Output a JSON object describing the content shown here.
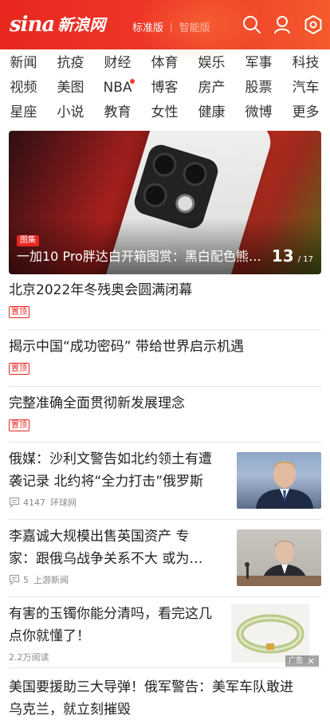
{
  "header": {
    "logo_en": "sina",
    "logo_cn": "新浪网",
    "version_active": "标准版",
    "version_separator": "|",
    "version_inactive": "智能版",
    "icons": [
      "search-icon",
      "user-icon",
      "settings-icon"
    ]
  },
  "nav": {
    "rows": [
      [
        "新闻",
        "抗疫",
        "财经",
        "体育",
        "娱乐",
        "军事",
        "科技"
      ],
      [
        "视频",
        "美图",
        "NBA",
        "博客",
        "房产",
        "股票",
        "汽车"
      ],
      [
        "星座",
        "小说",
        "教育",
        "女性",
        "健康",
        "微博",
        "更多"
      ]
    ],
    "dot_item": "NBA"
  },
  "hero": {
    "tag": "图集",
    "title": "一加10 Pro胖达白开箱图赏：黑白配色熊…",
    "current": "13",
    "total": "/ 17"
  },
  "news": [
    {
      "title": "北京2022年冬残奥会圆满闭幕",
      "pin": "置顶"
    },
    {
      "title": "揭示中国“成功密码” 带给世界启示机遇",
      "pin": "置顶"
    },
    {
      "title": "完整准确全面贯彻新发展理念",
      "pin": "置顶"
    },
    {
      "title_l1": "俄媒：沙利文警告如北约领土有遭",
      "title_l2": "袭记录 北约将“全力打击”俄罗斯",
      "comments": "4147",
      "source": "环球网"
    },
    {
      "title_l1": "李嘉诚大规模出售英国资产 专",
      "title_l2": "家：跟俄乌战争关系不大 或为…",
      "comments": "5",
      "source": "上游新闻"
    },
    {
      "title_l1": "有害的玉镯你能分清吗，看完这几",
      "title_l2": "点你就懂了！",
      "reads": "2.2万阅读",
      "ad": "广告"
    },
    {
      "title_l1": "美国要援助三大导弹！俄军警告：美军车队敢进",
      "title_l2": "乌克兰，就立刻摧毁"
    }
  ],
  "colors": {
    "brand_red": "#e8271f",
    "text": "#222222",
    "meta": "#888888"
  }
}
